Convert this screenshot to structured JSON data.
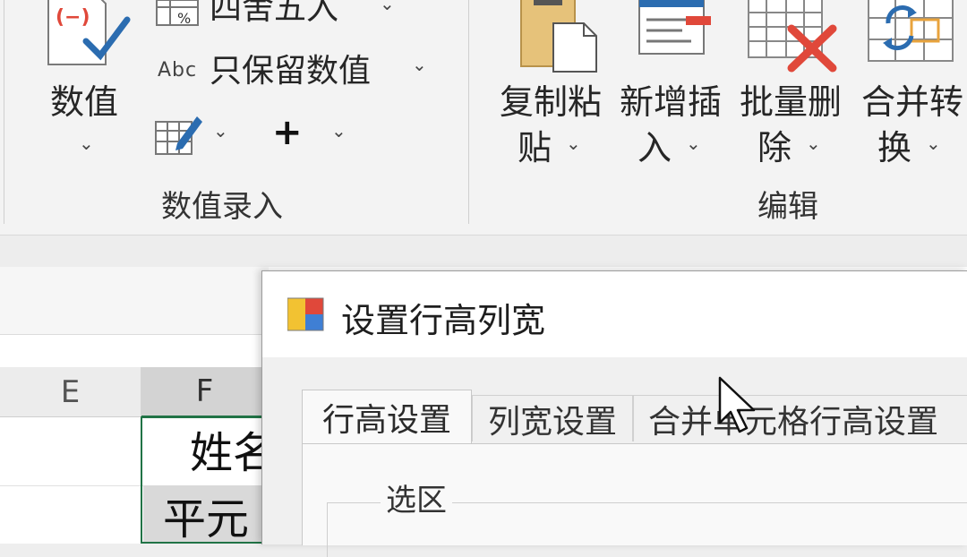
{
  "ribbon": {
    "number_group": {
      "big_button_label": "数值",
      "round_label": "四舍五入",
      "keep_values_label": "只保留数值",
      "plus_symbol": "+",
      "group_label": "数值录入"
    },
    "edit_group": {
      "copy_paste_label_line1": "复制粘",
      "copy_paste_label_line2": "贴",
      "insert_label_line1": "新增插",
      "insert_label_line2": "入",
      "batch_delete_label_line1": "批量删",
      "batch_delete_label_line2": "除",
      "merge_convert_label_line1": "合并转",
      "merge_convert_label_line2": "换",
      "group_label": "编辑"
    },
    "abc_text": "Abc"
  },
  "sheet": {
    "columns": [
      "E",
      "F"
    ],
    "cells": {
      "f1": "姓名",
      "f2": "平元"
    }
  },
  "dialog": {
    "title": "设置行高列宽",
    "tabs": [
      "行高设置",
      "列宽设置",
      "合并单元格行高设置"
    ],
    "active_tab": 0,
    "selection_group_title": "选区"
  },
  "colors": {
    "accent_green": "#217346",
    "icon_blue": "#2b6cb0",
    "icon_red": "#e0483a"
  }
}
